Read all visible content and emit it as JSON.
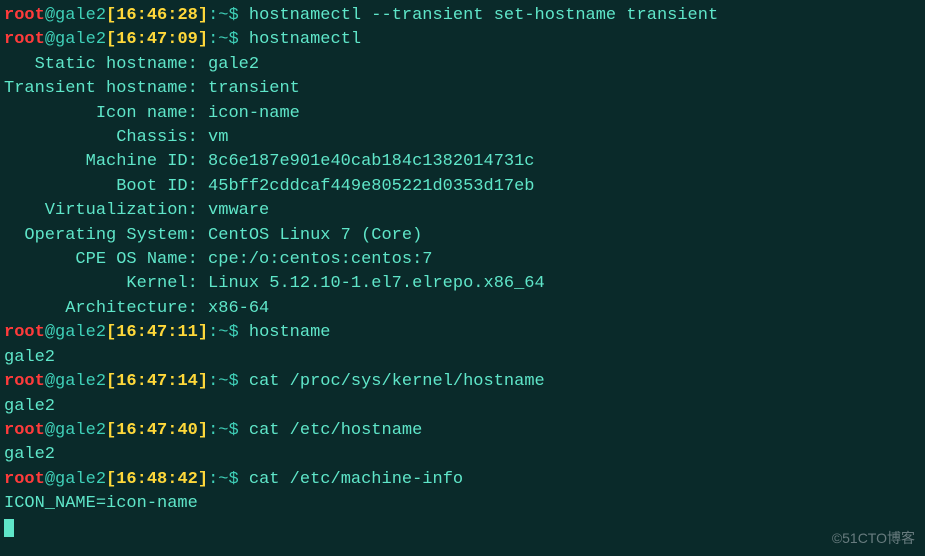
{
  "prompts": [
    {
      "user": "root",
      "at": "@",
      "host": "gale2",
      "time": "[16:46:28]",
      "tail": ":~$ ",
      "cmd": "hostnamectl --transient set-hostname transient"
    },
    {
      "user": "root",
      "at": "@",
      "host": "gale2",
      "time": "[16:47:09]",
      "tail": ":~$ ",
      "cmd": "hostnamectl"
    }
  ],
  "info": [
    {
      "label": "   Static hostname: ",
      "value": "gale2"
    },
    {
      "label": "Transient hostname: ",
      "value": "transient"
    },
    {
      "label": "         Icon name: ",
      "value": "icon-name"
    },
    {
      "label": "           Chassis: ",
      "value": "vm"
    },
    {
      "label": "        Machine ID: ",
      "value": "8c6e187e901e40cab184c1382014731c"
    },
    {
      "label": "           Boot ID: ",
      "value": "45bff2cddcaf449e805221d0353d17eb"
    },
    {
      "label": "    Virtualization: ",
      "value": "vmware"
    },
    {
      "label": "  Operating System: ",
      "value": "CentOS Linux 7 (Core)"
    },
    {
      "label": "       CPE OS Name: ",
      "value": "cpe:/o:centos:centos:7"
    },
    {
      "label": "            Kernel: ",
      "value": "Linux 5.12.10-1.el7.elrepo.x86_64"
    },
    {
      "label": "      Architecture: ",
      "value": "x86-64"
    }
  ],
  "tail": [
    {
      "type": "prompt",
      "user": "root",
      "at": "@",
      "host": "gale2",
      "time": "[16:47:11]",
      "ptail": ":~$ ",
      "cmd": "hostname"
    },
    {
      "type": "out",
      "text": "gale2"
    },
    {
      "type": "prompt",
      "user": "root",
      "at": "@",
      "host": "gale2",
      "time": "[16:47:14]",
      "ptail": ":~$ ",
      "cmd": "cat /proc/sys/kernel/hostname"
    },
    {
      "type": "out",
      "text": "gale2"
    },
    {
      "type": "prompt",
      "user": "root",
      "at": "@",
      "host": "gale2",
      "time": "[16:47:40]",
      "ptail": ":~$ ",
      "cmd": "cat /etc/hostname"
    },
    {
      "type": "out",
      "text": "gale2"
    },
    {
      "type": "prompt",
      "user": "root",
      "at": "@",
      "host": "gale2",
      "time": "[16:48:42]",
      "ptail": ":~$ ",
      "cmd": "cat /etc/machine-info"
    },
    {
      "type": "out",
      "text": "ICON_NAME=icon-name"
    }
  ],
  "watermark": "©51CTO博客"
}
